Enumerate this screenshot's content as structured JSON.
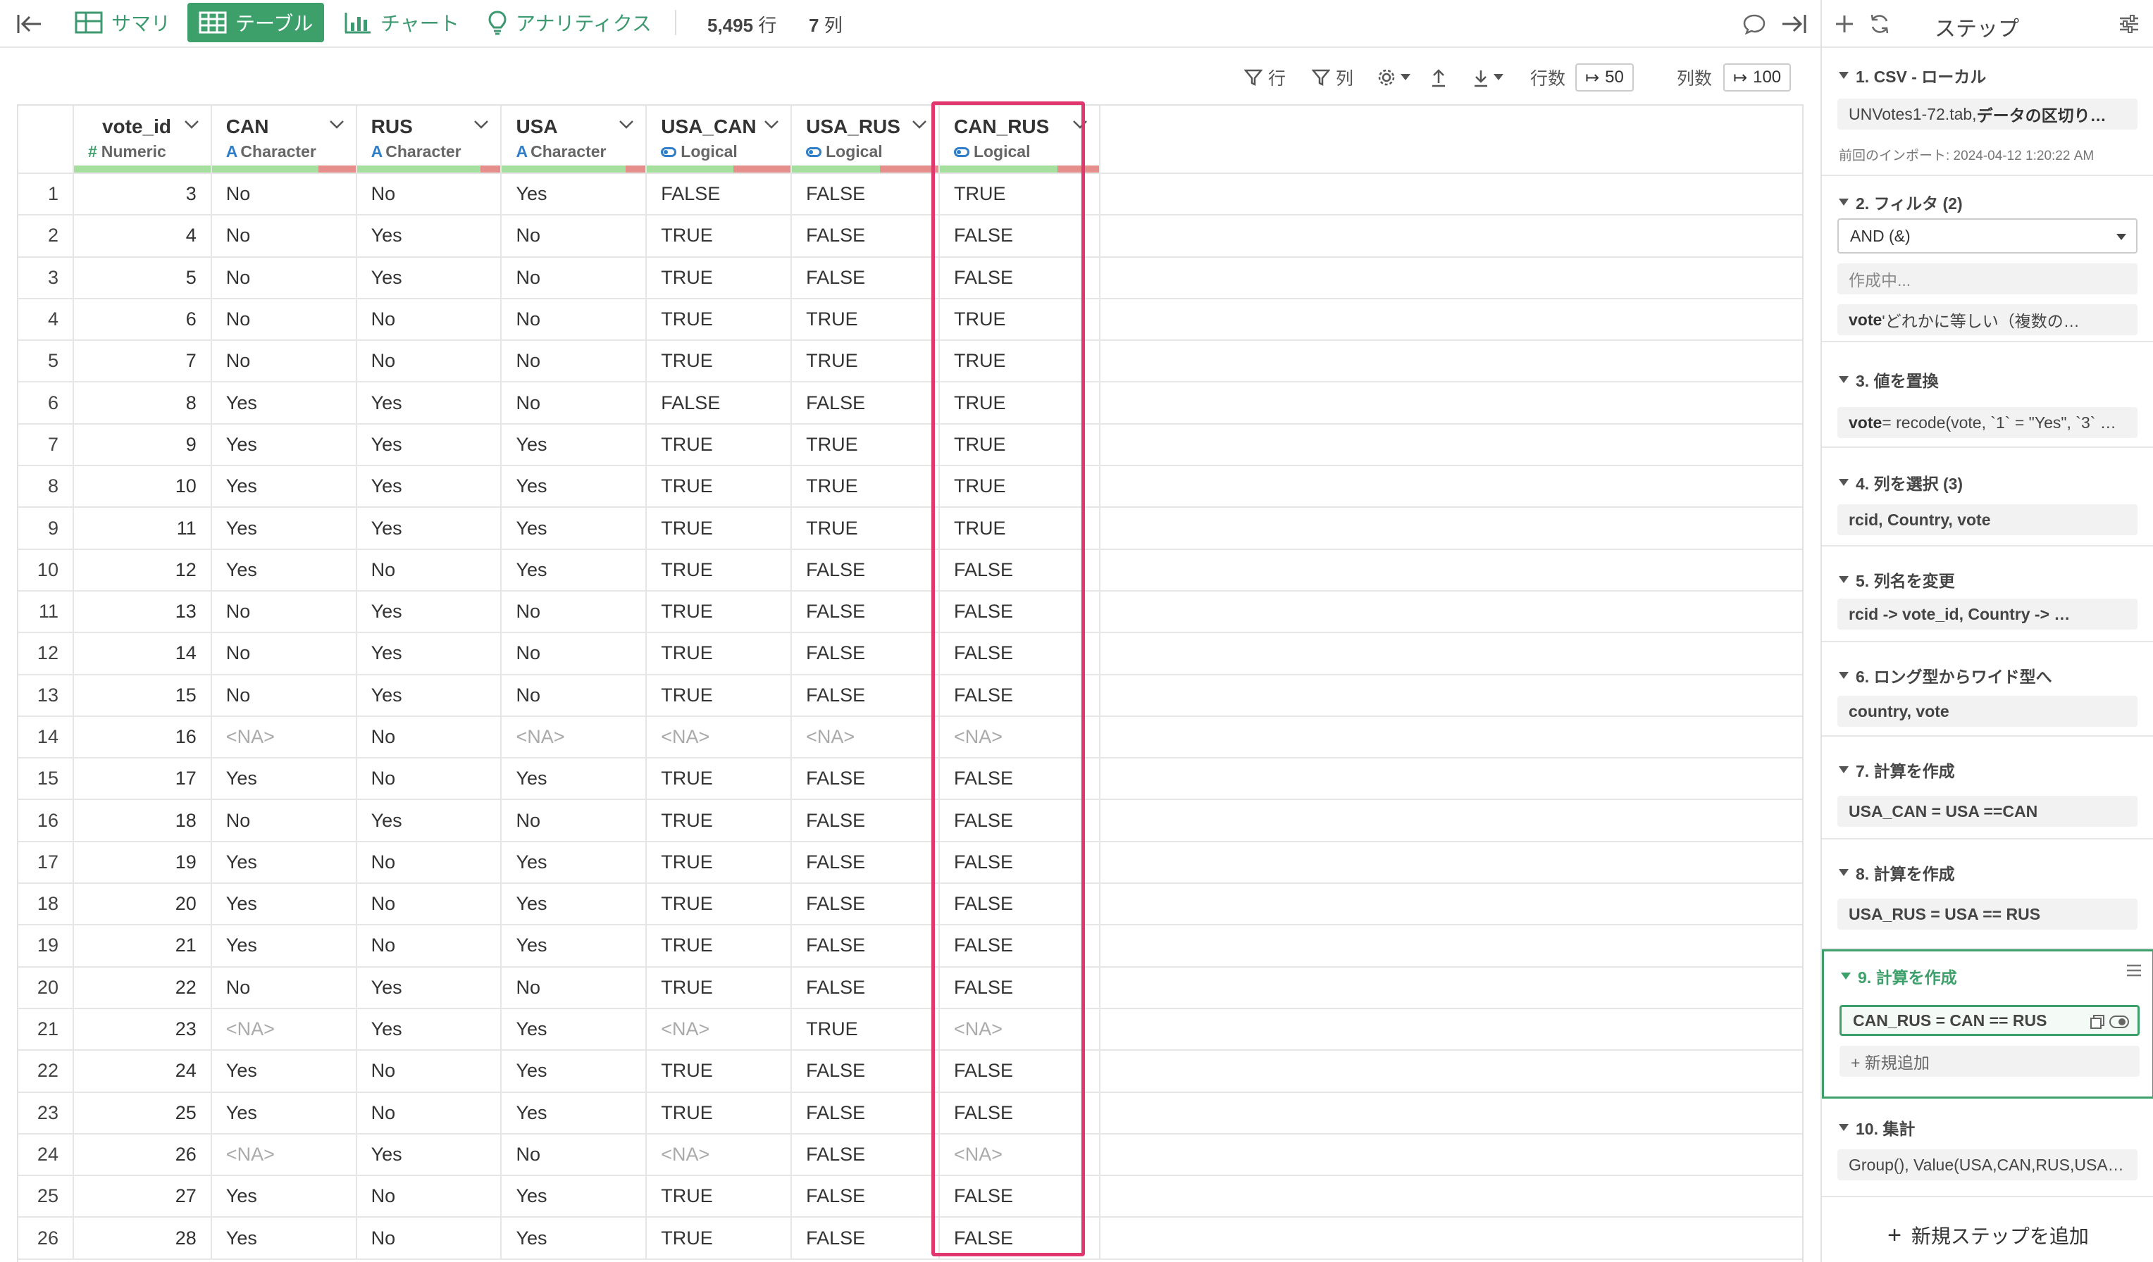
{
  "toolbar": {
    "tabs": [
      {
        "label": "サマリ"
      },
      {
        "label": "テーブル"
      },
      {
        "label": "チャート"
      },
      {
        "label": "アナリティクス"
      }
    ],
    "rows_count": "5,495",
    "rows_unit": "行",
    "cols_count": "7",
    "cols_unit": "列"
  },
  "subbar": {
    "filter_rows": "行",
    "filter_cols": "列",
    "rows_label": "行数",
    "rows_value": "50",
    "cols_label": "列数",
    "cols_value": "100"
  },
  "table": {
    "columns": [
      {
        "name": "vote_id",
        "type": "Numeric"
      },
      {
        "name": "CAN",
        "type": "Character"
      },
      {
        "name": "RUS",
        "type": "Character"
      },
      {
        "name": "USA",
        "type": "Character"
      },
      {
        "name": "USA_CAN",
        "type": "Logical"
      },
      {
        "name": "USA_RUS",
        "type": "Logical"
      },
      {
        "name": "CAN_RUS",
        "type": "Logical"
      }
    ],
    "na_text": "<NA>",
    "rows": [
      [
        "1",
        "3",
        "No",
        "No",
        "Yes",
        "FALSE",
        "FALSE",
        "TRUE"
      ],
      [
        "2",
        "4",
        "No",
        "Yes",
        "No",
        "TRUE",
        "FALSE",
        "FALSE"
      ],
      [
        "3",
        "5",
        "No",
        "Yes",
        "No",
        "TRUE",
        "FALSE",
        "FALSE"
      ],
      [
        "4",
        "6",
        "No",
        "No",
        "No",
        "TRUE",
        "TRUE",
        "TRUE"
      ],
      [
        "5",
        "7",
        "No",
        "No",
        "No",
        "TRUE",
        "TRUE",
        "TRUE"
      ],
      [
        "6",
        "8",
        "Yes",
        "Yes",
        "No",
        "FALSE",
        "FALSE",
        "TRUE"
      ],
      [
        "7",
        "9",
        "Yes",
        "Yes",
        "Yes",
        "TRUE",
        "TRUE",
        "TRUE"
      ],
      [
        "8",
        "10",
        "Yes",
        "Yes",
        "Yes",
        "TRUE",
        "TRUE",
        "TRUE"
      ],
      [
        "9",
        "11",
        "Yes",
        "Yes",
        "Yes",
        "TRUE",
        "TRUE",
        "TRUE"
      ],
      [
        "10",
        "12",
        "Yes",
        "No",
        "Yes",
        "TRUE",
        "FALSE",
        "FALSE"
      ],
      [
        "11",
        "13",
        "No",
        "Yes",
        "No",
        "TRUE",
        "FALSE",
        "FALSE"
      ],
      [
        "12",
        "14",
        "No",
        "Yes",
        "No",
        "TRUE",
        "FALSE",
        "FALSE"
      ],
      [
        "13",
        "15",
        "No",
        "Yes",
        "No",
        "TRUE",
        "FALSE",
        "FALSE"
      ],
      [
        "14",
        "16",
        "<NA>",
        "No",
        "<NA>",
        "<NA>",
        "<NA>",
        "<NA>"
      ],
      [
        "15",
        "17",
        "Yes",
        "No",
        "Yes",
        "TRUE",
        "FALSE",
        "FALSE"
      ],
      [
        "16",
        "18",
        "No",
        "Yes",
        "No",
        "TRUE",
        "FALSE",
        "FALSE"
      ],
      [
        "17",
        "19",
        "Yes",
        "No",
        "Yes",
        "TRUE",
        "FALSE",
        "FALSE"
      ],
      [
        "18",
        "20",
        "Yes",
        "No",
        "Yes",
        "TRUE",
        "FALSE",
        "FALSE"
      ],
      [
        "19",
        "21",
        "Yes",
        "No",
        "Yes",
        "TRUE",
        "FALSE",
        "FALSE"
      ],
      [
        "20",
        "22",
        "No",
        "Yes",
        "No",
        "TRUE",
        "FALSE",
        "FALSE"
      ],
      [
        "21",
        "23",
        "<NA>",
        "Yes",
        "Yes",
        "<NA>",
        "TRUE",
        "<NA>"
      ],
      [
        "22",
        "24",
        "Yes",
        "No",
        "Yes",
        "TRUE",
        "FALSE",
        "FALSE"
      ],
      [
        "23",
        "25",
        "Yes",
        "No",
        "Yes",
        "TRUE",
        "FALSE",
        "FALSE"
      ],
      [
        "24",
        "26",
        "<NA>",
        "Yes",
        "No",
        "<NA>",
        "FALSE",
        "<NA>"
      ],
      [
        "25",
        "27",
        "Yes",
        "No",
        "Yes",
        "TRUE",
        "FALSE",
        "FALSE"
      ],
      [
        "26",
        "28",
        "Yes",
        "No",
        "Yes",
        "TRUE",
        "FALSE",
        "FALSE"
      ]
    ]
  },
  "panel": {
    "title": "ステップ",
    "steps": {
      "s1": {
        "title": "1. CSV - ローカル",
        "box_pre": "UNVotes1-72.tab, ",
        "box_bold": "データの区切り…",
        "note": "前回のインポート: 2024-04-12 1:20:22 AM"
      },
      "s2": {
        "title": "2. フィルタ (2)",
        "select": "AND (&)",
        "box1": "作成中...",
        "box2_bold": "vote",
        "box2_rest": " 'どれかに等しい（複数の…"
      },
      "s3": {
        "title": "3. 値を置換",
        "box_bold": "vote",
        "box_rest": " = recode(vote, `1` = \"Yes\", `3` …"
      },
      "s4": {
        "title": "4. 列を選択 (3)",
        "box": "rcid, Country, vote"
      },
      "s5": {
        "title": "5. 列名を変更",
        "box": "rcid -> vote_id, Country -> …"
      },
      "s6": {
        "title": "6. ロング型からワイド型へ",
        "box": "country, vote"
      },
      "s7": {
        "title": "7. 計算を作成",
        "box": "USA_CAN = USA ==CAN"
      },
      "s8": {
        "title": "8. 計算を作成",
        "box": "USA_RUS = USA == RUS"
      },
      "s9": {
        "title": "9. 計算を作成",
        "box": "CAN_RUS = CAN == RUS",
        "add_label": "+ 新規追加"
      },
      "s10": {
        "title": "10. 集計",
        "box": "Group(), Value(USA,CAN,RUS,USA…"
      }
    },
    "add_step": "新規ステップを追加"
  },
  "colors": {
    "accent_green": "#3da06b",
    "highlight_pink": "#e0386e",
    "type_blue": "#2f7ec7"
  }
}
